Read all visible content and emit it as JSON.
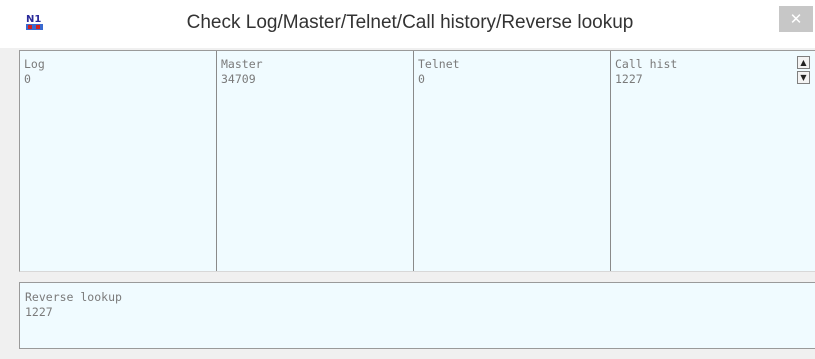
{
  "window": {
    "title": "Check Log/Master/Telnet/Call history/Reverse lookup",
    "close_label": "✕",
    "app_icon": "n1mm-logo-icon"
  },
  "columns": [
    {
      "header": "Log",
      "value": "0"
    },
    {
      "header": "Master",
      "value": "34709"
    },
    {
      "header": "Telnet",
      "value": "0"
    },
    {
      "header": "Call hist",
      "value": "1227"
    }
  ],
  "scrollbar": {
    "up_icon": "arrow-up-icon",
    "down_icon": "arrow-down-icon",
    "up_label": "▲",
    "down_label": "▼"
  },
  "reverse_lookup": {
    "header": "Reverse lookup",
    "value": "1227"
  },
  "colors": {
    "panel_bg": "#f0fbff",
    "window_bg": "#f0f0f0",
    "text": "#7a7a7a"
  }
}
